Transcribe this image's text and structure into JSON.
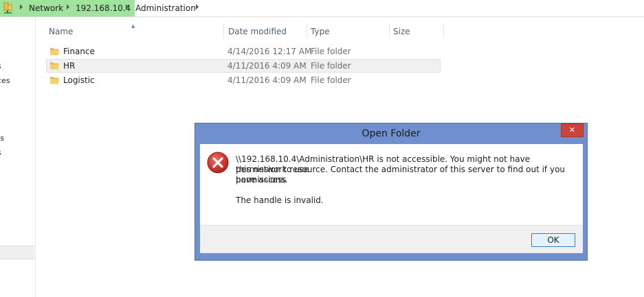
{
  "address_bar": {
    "crumbs": [
      "Network",
      "192.168.10.4",
      "Administration"
    ]
  },
  "nav_pane": {
    "items": [
      "s",
      "ces",
      "ts",
      "s"
    ]
  },
  "file_list": {
    "columns": [
      "Name",
      "Date modified",
      "Type",
      "Size"
    ],
    "rows": [
      {
        "name": "Finance",
        "date": "4/14/2016 12:17 AM",
        "type": "File folder"
      },
      {
        "name": "HR",
        "date": "4/11/2016 4:09 AM",
        "type": "File folder"
      },
      {
        "name": "Logistic",
        "date": "4/11/2016 4:09 AM",
        "type": "File folder"
      }
    ]
  },
  "dialog": {
    "title": "Open Folder",
    "message_line1": "\\\\192.168.10.4\\Administration\\HR is not accessible. You might not have permission to use",
    "message_line2": "this network resource. Contact the administrator of this server to find out if you have access",
    "message_line3": "permissions.",
    "detail": "The handle is invalid.",
    "ok_label": "OK"
  }
}
